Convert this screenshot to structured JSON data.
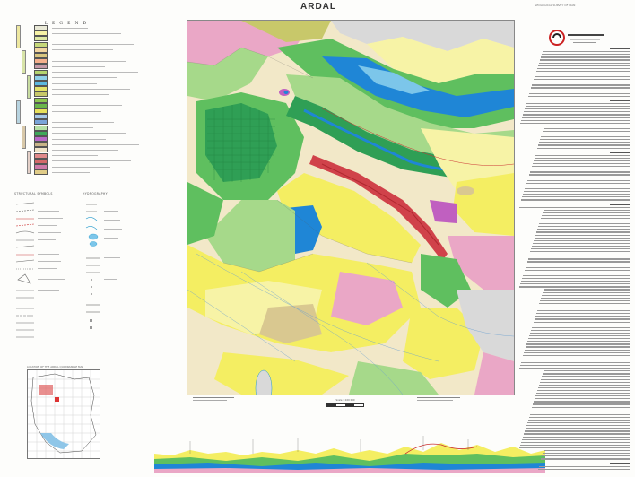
{
  "title": "ARDAL",
  "top_right_note": "GEOLOGICAL SURVEY OF IRAN",
  "legend": {
    "heading": "L E G E N D",
    "units": [
      {
        "color": "#e9e9d6"
      },
      {
        "color": "#f6f2a6"
      },
      {
        "color": "#dfe9a4"
      },
      {
        "color": "#c6d87a"
      },
      {
        "color": "#f2d6a0"
      },
      {
        "color": "#d9c67f"
      },
      {
        "color": "#f4b08c"
      },
      {
        "color": "#c59aa8"
      },
      {
        "color": "#b5d46f"
      },
      {
        "color": "#8fd0e8"
      },
      {
        "color": "#5cb8e0"
      },
      {
        "color": "#e4e36a"
      },
      {
        "color": "#c8c86a"
      },
      {
        "color": "#8ec850"
      },
      {
        "color": "#6ab64a"
      },
      {
        "color": "#e8e05a"
      },
      {
        "color": "#a6c8e8"
      },
      {
        "color": "#7aa4d8"
      },
      {
        "color": "#b6e0a6"
      },
      {
        "color": "#3ea85a"
      },
      {
        "color": "#ba68c8"
      },
      {
        "color": "#c8b488"
      },
      {
        "color": "#f0e4c8"
      },
      {
        "color": "#e08a8a"
      },
      {
        "color": "#d46a6a"
      },
      {
        "color": "#ce7aa8"
      },
      {
        "color": "#e0cc88"
      }
    ],
    "symbols_heading": "STRUCTURAL SYMBOLS",
    "hydro_heading": "HYDROGRAPHY"
  },
  "inset": {
    "title": "LOCATION OF THE ARDAL QUADRANGLE MAP"
  },
  "scale_text": "Scale 1:100 000",
  "colors": {
    "pink": "#eaa7c6",
    "yellow": "#f4ee62",
    "light_yellow": "#f7f3a6",
    "green": "#5fbf5f",
    "dark_green": "#2f9f55",
    "light_green": "#a6d98a",
    "blue": "#1f86d6",
    "light_blue": "#7cc6ea",
    "cream": "#f2e8c8",
    "tan": "#d9c890",
    "gray": "#d9d9d9",
    "red": "#d0424a",
    "purple": "#c060c0"
  }
}
